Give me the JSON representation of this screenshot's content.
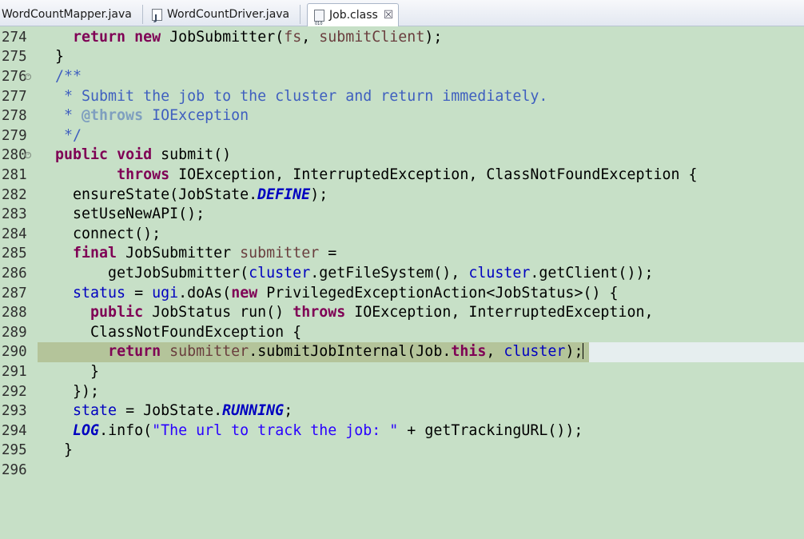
{
  "tabs": [
    {
      "label": "WordCountMapper.java",
      "icon": "java-file-icon",
      "active": false
    },
    {
      "label": "WordCountDriver.java",
      "icon": "java-file-icon",
      "active": false
    },
    {
      "label": "Job.class",
      "icon": "class-file-icon",
      "active": true,
      "close": "☒"
    }
  ],
  "editor": {
    "highlight_line": "290",
    "lines": [
      {
        "num": "274",
        "fold": false
      },
      {
        "num": "275",
        "fold": false
      },
      {
        "num": "276",
        "fold": true
      },
      {
        "num": "277",
        "fold": false
      },
      {
        "num": "278",
        "fold": false
      },
      {
        "num": "279",
        "fold": false
      },
      {
        "num": "280",
        "fold": true
      },
      {
        "num": "281",
        "fold": false
      },
      {
        "num": "282",
        "fold": false
      },
      {
        "num": "283",
        "fold": false
      },
      {
        "num": "284",
        "fold": false
      },
      {
        "num": "285",
        "fold": false
      },
      {
        "num": "286",
        "fold": false
      },
      {
        "num": "287",
        "fold": false
      },
      {
        "num": "288",
        "fold": false
      },
      {
        "num": "289",
        "fold": false
      },
      {
        "num": "290",
        "fold": false
      },
      {
        "num": "291",
        "fold": false
      },
      {
        "num": "292",
        "fold": false
      },
      {
        "num": "293",
        "fold": false
      },
      {
        "num": "294",
        "fold": false
      },
      {
        "num": "295",
        "fold": false
      },
      {
        "num": "296",
        "fold": false
      }
    ],
    "code": {
      "l274": [
        "    ",
        "return",
        " ",
        "new",
        " JobSubmitter(",
        "fs",
        ", ",
        "submitClient",
        ");"
      ],
      "l275": [
        "  }"
      ],
      "l276": [
        "  /**"
      ],
      "l277": [
        "   * Submit the job to the cluster and return immediately."
      ],
      "l278": [
        "   * ",
        "@throws",
        " IOException"
      ],
      "l279": [
        "   */"
      ],
      "l280": [
        "  ",
        "public",
        " ",
        "void",
        " submit()"
      ],
      "l281": [
        "         ",
        "throws",
        " IOException, InterruptedException, ClassNotFoundException {"
      ],
      "l282": [
        "    ensureState(JobState.",
        "DEFINE",
        ");"
      ],
      "l283": [
        "    setUseNewAPI();"
      ],
      "l284": [
        "    connect();"
      ],
      "l285": [
        "    ",
        "final",
        " JobSubmitter ",
        "submitter",
        " ="
      ],
      "l286": [
        "        getJobSubmitter(",
        "cluster",
        ".getFileSystem(), ",
        "cluster",
        ".getClient());"
      ],
      "l287": [
        "    ",
        "status",
        " = ",
        "ugi",
        ".doAs(",
        "new",
        " PrivilegedExceptionAction<JobStatus>() {"
      ],
      "l288": [
        "      ",
        "public",
        " JobStatus run() ",
        "throws",
        " IOException, InterruptedException,"
      ],
      "l289": [
        "      ClassNotFoundException {"
      ],
      "l290": [
        "        ",
        "return",
        " ",
        "submitter",
        ".submitJobInternal(Job.",
        "this",
        ", ",
        "cluster",
        ");"
      ],
      "l291": [
        "      }"
      ],
      "l292": [
        "    });"
      ],
      "l293": [
        "    ",
        "state",
        " = JobState.",
        "RUNNING",
        ";"
      ],
      "l294": [
        "    ",
        "LOG",
        ".info(",
        "\"The url to track the job: \"",
        " + getTrackingURL());"
      ],
      "l295": [
        "   }"
      ],
      "l296": [
        ""
      ]
    }
  },
  "colors": {
    "editor_background": "#c7e0c7",
    "current_line": "#b4c49a",
    "keyword": "#7f0055",
    "javadoc": "#3f5fbf",
    "field": "#0000c0",
    "local_variable": "#6a3e3e",
    "string": "#2a00ff"
  }
}
